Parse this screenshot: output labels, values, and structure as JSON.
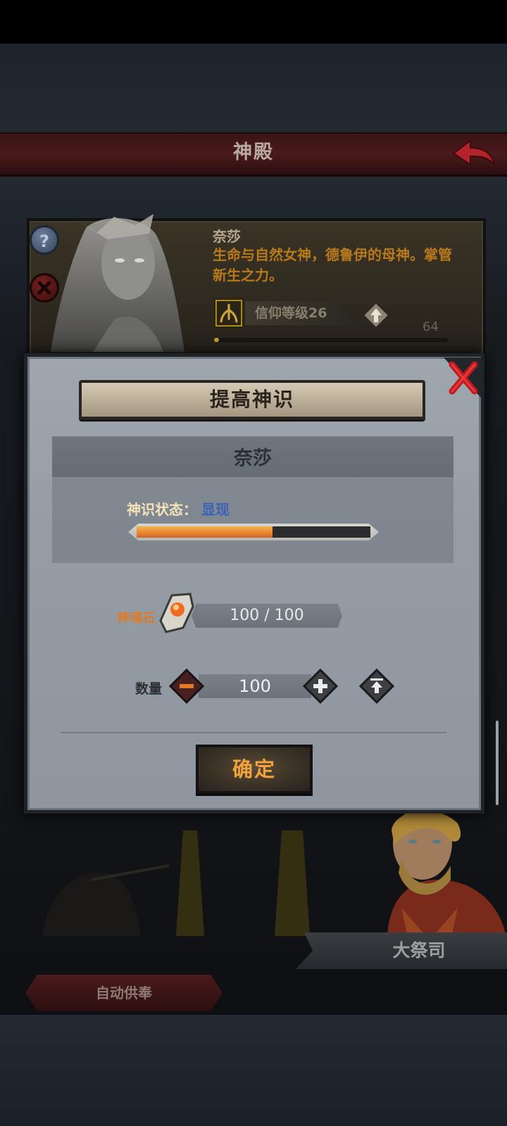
{
  "header": {
    "title": "神殿"
  },
  "god_card": {
    "name": "奈莎",
    "description": "生命与自然女神，德鲁伊的母神。掌管新生之力。",
    "faith_label": "信仰等级26",
    "faith_count": "64",
    "faith_progress": 0.02
  },
  "modal": {
    "title": "提高神识",
    "god_name": "奈莎",
    "status_label": "神识状态：",
    "status_value": "显现",
    "status_progress": 0.58,
    "stone_label": "神魂石",
    "stone_value": "100 / 100",
    "quantity_label": "数量",
    "quantity_value": "100",
    "confirm_label": "确定"
  },
  "bottom": {
    "role_label": "大祭司",
    "auto_offer_label": "自动供奉"
  },
  "colors": {
    "title_banner": "#4a1a1b",
    "god_description": "#b8791b",
    "status_value": "#3a63b7",
    "progress_fill": "#e8852f",
    "confirm_text": "#f0a23c"
  },
  "icons": [
    "back-arrow-icon",
    "help-icon",
    "close-icon",
    "faith-symbol-icon",
    "upgrade-icon",
    "soul-stone-icon",
    "minus-icon",
    "plus-icon",
    "max-icon"
  ]
}
